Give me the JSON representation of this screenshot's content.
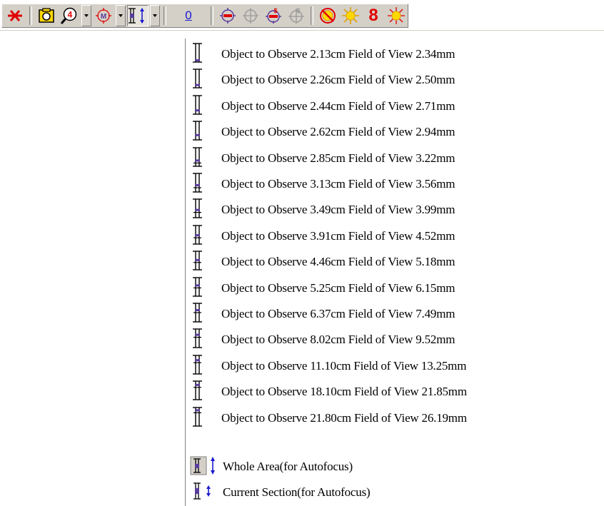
{
  "toolbar": {
    "buttons": [
      {
        "name": "close-cross-icon",
        "kind": "icon"
      },
      {
        "name": "camera-snapshot-icon",
        "kind": "icon"
      },
      {
        "name": "zoom-4-icon",
        "kind": "icon",
        "dropdown": true
      },
      {
        "name": "measure-m-icon",
        "kind": "icon",
        "dropdown": true
      },
      {
        "name": "field-of-view-icon",
        "kind": "icon",
        "dropdown": true,
        "pressed": true
      },
      {
        "name": "zero-button",
        "kind": "text"
      },
      {
        "name": "target-red-icon",
        "kind": "icon"
      },
      {
        "name": "target-gray-icon",
        "kind": "icon"
      },
      {
        "name": "target-dollar-red-icon",
        "kind": "icon"
      },
      {
        "name": "target-dollar-gray-icon",
        "kind": "icon"
      },
      {
        "name": "no-light-icon",
        "kind": "icon"
      },
      {
        "name": "light-on-icon",
        "kind": "icon"
      },
      {
        "name": "digit-eight-button",
        "kind": "text"
      },
      {
        "name": "light-burst-icon",
        "kind": "icon"
      }
    ],
    "zero_label": "0",
    "eight_label": "8"
  },
  "menu": {
    "items": [
      {
        "label": "Object to Observe 2.13cm Field of View 2.34mm",
        "level": 0
      },
      {
        "label": "Object to Observe 2.26cm Field of View 2.50mm",
        "level": 1
      },
      {
        "label": "Object to Observe 2.44cm Field of View 2.71mm",
        "level": 2
      },
      {
        "label": "Object to Observe 2.62cm Field of View 2.94mm",
        "level": 3
      },
      {
        "label": "Object to Observe 2.85cm Field of View 3.22mm",
        "level": 4
      },
      {
        "label": "Object to Observe 3.13cm Field of View 3.56mm",
        "level": 5
      },
      {
        "label": "Object to Observe 3.49cm Field of View 3.99mm",
        "level": 6
      },
      {
        "label": "Object to Observe 3.91cm Field of View 4.52mm",
        "level": 7
      },
      {
        "label": "Object to Observe 4.46cm Field of View 5.18mm",
        "level": 8
      },
      {
        "label": "Object to Observe 5.25cm Field of View 6.15mm",
        "level": 9
      },
      {
        "label": "Object to Observe 6.37cm Field of View 7.49mm",
        "level": 10
      },
      {
        "label": "Object to Observe 8.02cm Field of View 9.52mm",
        "level": 11
      },
      {
        "label": "Object to Observe 11.10cm Field of View 13.25mm",
        "level": 12
      },
      {
        "label": "Object to Observe 18.10cm Field of View 21.85mm",
        "level": 13
      },
      {
        "label": "Object to Observe 21.80cm Field of View 26.19mm",
        "level": 14
      }
    ],
    "whole_area_label": "Whole Area(for Autofocus)",
    "current_section_label": "Current Section(for Autofocus)"
  },
  "colors": {
    "face": "#d4d0c8",
    "accent_red": "#e00000",
    "accent_blue": "#1a1ad0",
    "icon_purple": "#5a3c9c",
    "sun_yellow": "#ffd800"
  }
}
